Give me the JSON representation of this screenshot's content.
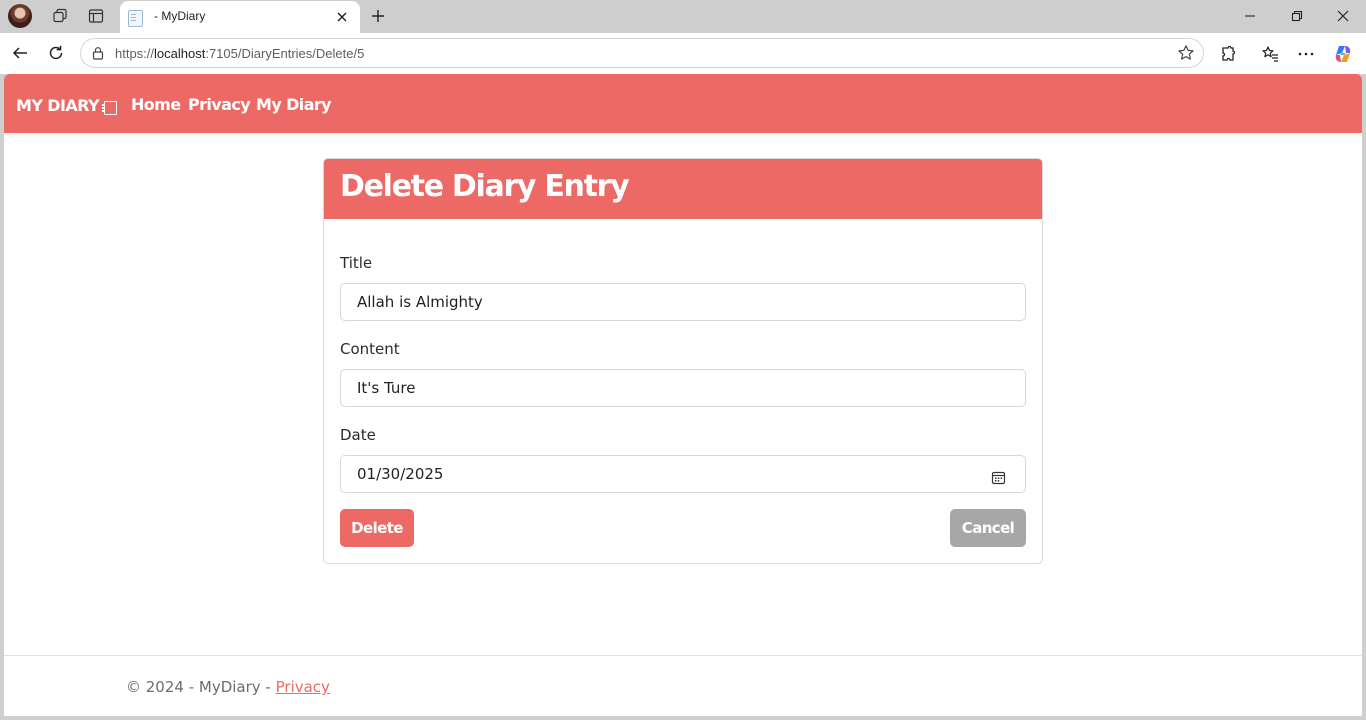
{
  "browser": {
    "tab_title": "- MyDiary",
    "url_prefix": "https://",
    "url_host": "localhost",
    "url_path": ":7105/DiaryEntries/Delete/5"
  },
  "navbar": {
    "brand": "MY DIARY",
    "links": [
      "Home",
      "Privacy",
      "My Diary"
    ]
  },
  "card": {
    "title": "Delete Diary Entry",
    "fields": [
      {
        "label": "Title",
        "value": "Allah is Almighty"
      },
      {
        "label": "Content",
        "value": "It's Ture"
      },
      {
        "label": "Date",
        "value": "01/30/2025"
      }
    ],
    "delete_label": "Delete",
    "cancel_label": "Cancel"
  },
  "footer": {
    "text": "© 2024 - MyDiary - ",
    "link": "Privacy"
  },
  "colors": {
    "accent": "#ec6966",
    "cancel": "#a7a7a7"
  }
}
